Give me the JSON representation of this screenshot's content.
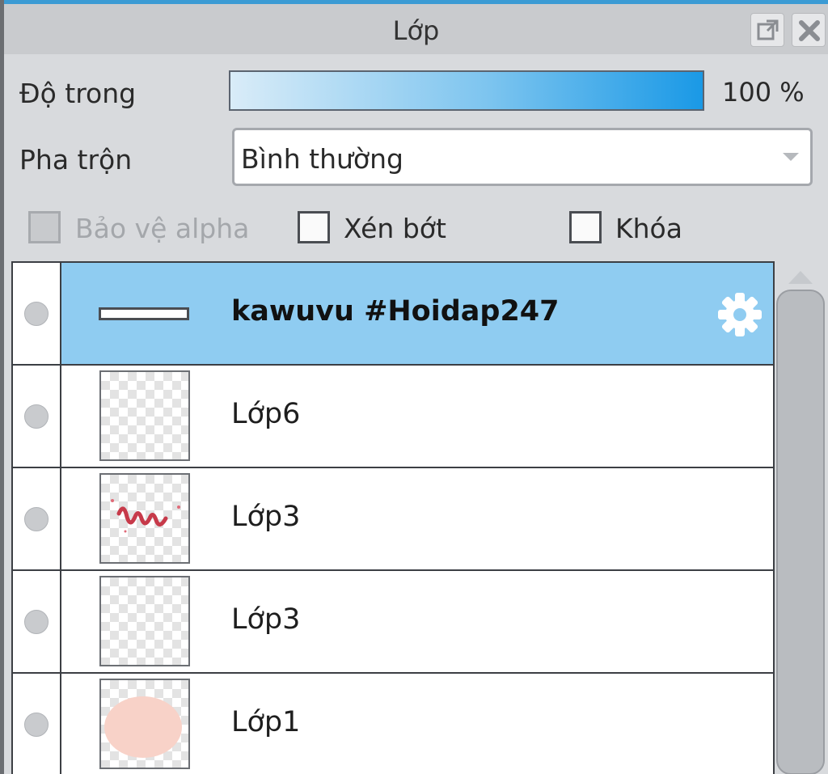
{
  "panel": {
    "title": "Lớp",
    "icons": {
      "popout": "popout-icon",
      "close": "close-icon"
    }
  },
  "opacity": {
    "label": "Độ trong",
    "value_text": "100 %",
    "level_percent": 100
  },
  "blend": {
    "label": "Pha trộn",
    "value": "Bình thường"
  },
  "options": {
    "protect_alpha": {
      "label": "Bảo vệ alpha",
      "checked": false,
      "disabled": true
    },
    "clip": {
      "label": "Xén bớt",
      "checked": false
    },
    "lock": {
      "label": "Khóa",
      "checked": false
    }
  },
  "layers": [
    {
      "name": "kawuvu #Hoidap247",
      "selected": true,
      "thumbnail": "text-strip"
    },
    {
      "name": "Lớp6",
      "selected": false,
      "thumbnail": "empty"
    },
    {
      "name": "Lớp3",
      "selected": false,
      "thumbnail": "red-lettering"
    },
    {
      "name": "Lớp3",
      "selected": false,
      "thumbnail": "empty"
    },
    {
      "name": "Lớp1",
      "selected": false,
      "thumbnail": "pink-blob"
    }
  ],
  "colors": {
    "accent": "#3b9bd4",
    "selected_row": "#8fccf1",
    "opacity_gradient_end": "#1a99e6"
  }
}
